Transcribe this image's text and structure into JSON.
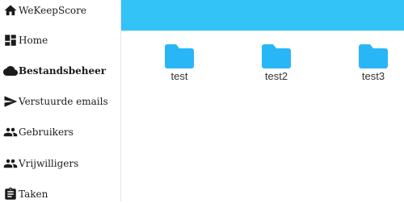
{
  "colors": {
    "accent": "#33c3f7",
    "folder": "#29b6f6",
    "icon": "#1b1b1b"
  },
  "sidebar": {
    "brand": {
      "label": "WeKeepScore",
      "icon": "home-icon"
    },
    "items": [
      {
        "label": "Home",
        "icon": "dashboard-icon"
      },
      {
        "label": "Bestandsbeheer",
        "icon": "cloud-icon",
        "active": true
      },
      {
        "label": "Verstuurde emails",
        "icon": "send-icon"
      },
      {
        "label": "Gebruikers",
        "icon": "people-icon"
      },
      {
        "label": "Vrijwilligers",
        "icon": "people-icon"
      },
      {
        "label": "Taken",
        "icon": "clipboard-icon"
      }
    ]
  },
  "main": {
    "folders": [
      {
        "name": "test",
        "icon": "folder-icon"
      },
      {
        "name": "test2",
        "icon": "folder-icon"
      },
      {
        "name": "test3",
        "icon": "folder-icon"
      }
    ]
  }
}
